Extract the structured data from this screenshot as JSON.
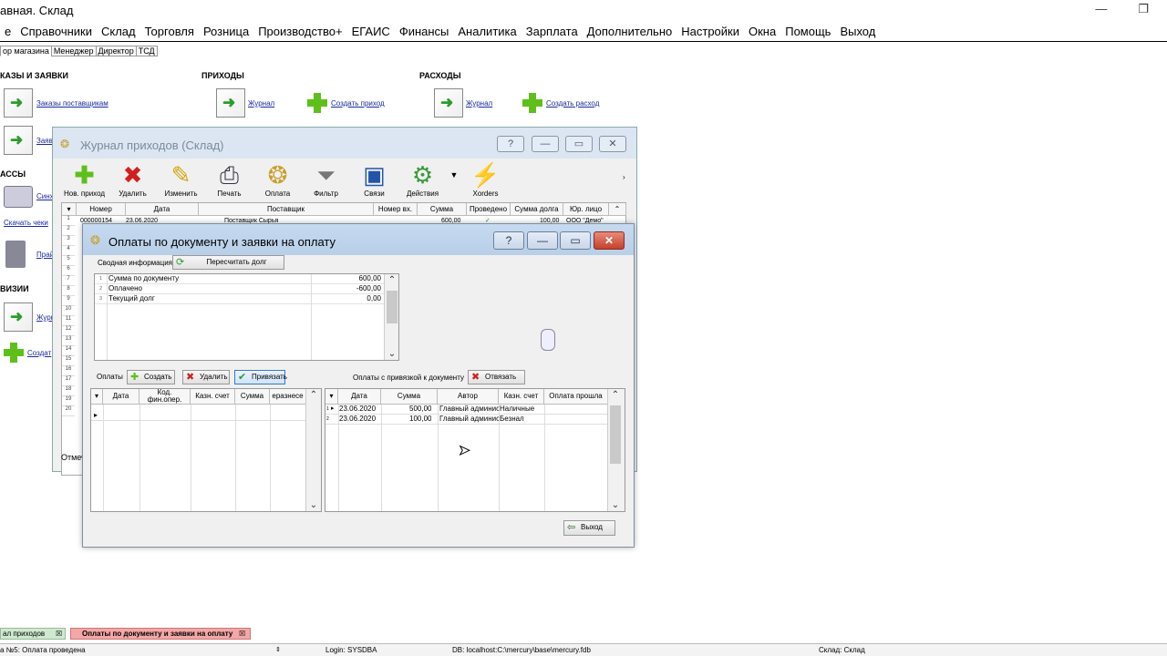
{
  "app": {
    "title": "авная. Склад"
  },
  "menu": [
    "е",
    "Справочники",
    "Склад",
    "Торговля",
    "Розница",
    "Производство+",
    "ЕГАИС",
    "Финансы",
    "Аналитика",
    "Зарплата",
    "Дополнительно",
    "Настройки",
    "Окна",
    "Помощь",
    "Выход"
  ],
  "top_tabs": [
    "ор магазина",
    "Менеджер",
    "Директор",
    "ТСД"
  ],
  "sections": {
    "orders": {
      "title": "КАЗЫ И ЗАЯВКИ",
      "link1": "Заказы поставщикам",
      "link2": "Заяв"
    },
    "incoming": {
      "title": "ПРИХОДЫ",
      "journal": "Журнал",
      "create": "Создать приход"
    },
    "outgoing": {
      "title": "РАСХОДЫ",
      "journal": "Журнал",
      "create": "Создать расход"
    },
    "cash": {
      "title": "АССЫ",
      "sync": "Синх",
      "download": "Скачать чеки"
    },
    "scales": {
      "price": "Прай"
    },
    "revision": {
      "title": "ВИЗИИ",
      "journal": "Журн",
      "create": "Создат"
    }
  },
  "journal": {
    "title": "Журнал приходов (Склад)",
    "toolbar": [
      "Нов. приход",
      "Удалить",
      "Изменить",
      "Печать",
      "Оплата",
      "Фильтр",
      "Связи",
      "Действия",
      "Xorders"
    ],
    "columns": [
      "Номер",
      "Дата",
      "Поставщик",
      "Номер вх.",
      "Сумма",
      "Проведено",
      "Сумма долга",
      "Юр. лицо"
    ],
    "row": {
      "number": "000000154",
      "date": "23.06.2020",
      "supplier": "Поставщик Сырья",
      "sum": "600,00",
      "posted": "✓",
      "debt": "100,00",
      "entity": "ООО \"Демо\""
    },
    "row_numbers": [
      "1",
      "2",
      "3",
      "4",
      "5",
      "6",
      "7",
      "8",
      "9",
      "10",
      "11",
      "12",
      "13",
      "14",
      "15",
      "16",
      "17",
      "18",
      "19",
      "20"
    ],
    "footer": "Отмеч"
  },
  "dialog": {
    "title": "Оплаты по документу и заявки на оплату",
    "summary_label": "Сводная информация",
    "recalc_button": "Пересчитать долг",
    "summary_rows": [
      {
        "n": "1",
        "name": "Сумма по документу",
        "value": "600,00"
      },
      {
        "n": "2",
        "name": "Оплачено",
        "value": "-600,00"
      },
      {
        "n": "3",
        "name": "Текущий долг",
        "value": "0,00"
      }
    ],
    "payments_label": "Оплаты",
    "create_button": "Создать",
    "delete_button": "Удалить",
    "bind_button": "Привязать",
    "linked_label": "Оплаты с привязкой к документу",
    "unbind_button": "Отвязать",
    "left_columns": [
      "Дата",
      "Код. фин.опер.",
      "Казн. счет",
      "Сумма",
      "еразнесе"
    ],
    "right_columns": [
      "Дата",
      "Сумма",
      "Автор",
      "Казн. счет",
      "Оплата прошла"
    ],
    "right_rows": [
      {
        "n": "1",
        "date": "23.06.2020",
        "sum": "500,00",
        "author": "Главный админист",
        "account": "Наличные"
      },
      {
        "n": "2",
        "date": "23.06.2020",
        "sum": "100,00",
        "author": "Главный админист",
        "account": "Безнал"
      }
    ],
    "exit_button": "Выход"
  },
  "bottom_tabs": {
    "tab1": "ал приходов",
    "tab2": "Оплаты по документу и заявки на оплату"
  },
  "status": {
    "message": "а №5: Оплата проведена",
    "login": "Login: SYSDBA",
    "db": "DB: localhost:C:\\mercury\\base\\mercury.fdb",
    "warehouse": "Склад: Склад"
  }
}
